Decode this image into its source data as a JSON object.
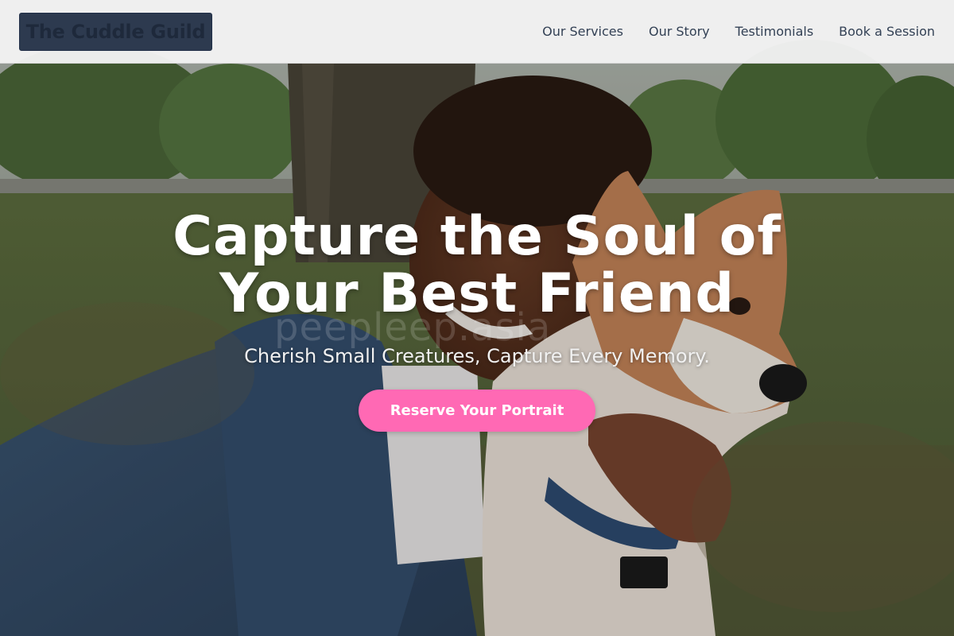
{
  "header": {
    "logo_text": "The Cuddle Guild",
    "nav": [
      {
        "label": "Our Services"
      },
      {
        "label": "Our Story"
      },
      {
        "label": "Testimonials"
      },
      {
        "label": "Book a Session"
      }
    ]
  },
  "hero": {
    "title": "Capture the Soul of Your Best Friend",
    "subtitle": "Cherish Small Creatures, Capture Every Memory.",
    "cta_label": "Reserve Your Portrait",
    "watermark": "peepleep.asia",
    "image_description": "photo-woman-hugging-shiba-inu-dog-in-park"
  },
  "colors": {
    "header_bg": "#f3f3f3",
    "logo_bg": "#2d3a4f",
    "nav_text": "#334155",
    "cta_bg": "#ff69b4",
    "cta_text": "#ffffff",
    "hero_text": "#ffffff"
  }
}
